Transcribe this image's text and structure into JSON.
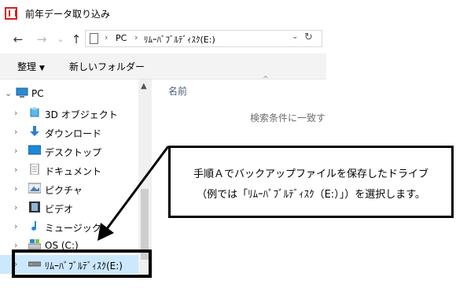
{
  "window": {
    "title": "前年データ取り込み"
  },
  "navigation": {
    "back_label": "←",
    "forward_label": "→",
    "dropdown_label": "⌄",
    "up_label": "↑",
    "address": {
      "segments": [
        "PC",
        "ﾘﾑｰﾊﾞﾌﾞﾙﾃﾞｨｽｸ(E:)"
      ],
      "separator": "›"
    }
  },
  "toolbar": {
    "organize_label": "整理",
    "new_folder_label": "新しいフォルダー"
  },
  "tree": {
    "pc_label": "PC",
    "items": [
      {
        "label": "3D オブジェクト",
        "icon": "3d-objects-icon"
      },
      {
        "label": "ダウンロード",
        "icon": "download-icon"
      },
      {
        "label": "デスクトップ",
        "icon": "desktop-icon"
      },
      {
        "label": "ドキュメント",
        "icon": "document-icon"
      },
      {
        "label": "ピクチャ",
        "icon": "pictures-icon"
      },
      {
        "label": "ビデオ",
        "icon": "video-icon"
      },
      {
        "label": "ミュージック",
        "icon": "music-icon"
      },
      {
        "label": "OS (C:)",
        "icon": "drive-icon"
      },
      {
        "label": "ﾘﾑｰﾊﾞﾌﾞﾙﾃﾞｨｽｸ(E:)",
        "icon": "removable-drive-icon",
        "selected": true
      }
    ]
  },
  "content": {
    "column_name": "名前",
    "empty_message": "検索条件に一致する"
  },
  "callout": {
    "line1": "手順Ａでバックアップファイルを保存したドライブ",
    "line2": "（例では「ﾘﾑｰﾊﾞﾌﾞﾙﾃﾞｨｽｸ（E:）」）を選択します。"
  },
  "colors": {
    "accent": "#0078d7",
    "selection": "#cce8ff",
    "app_icon": "#d81e1e"
  }
}
